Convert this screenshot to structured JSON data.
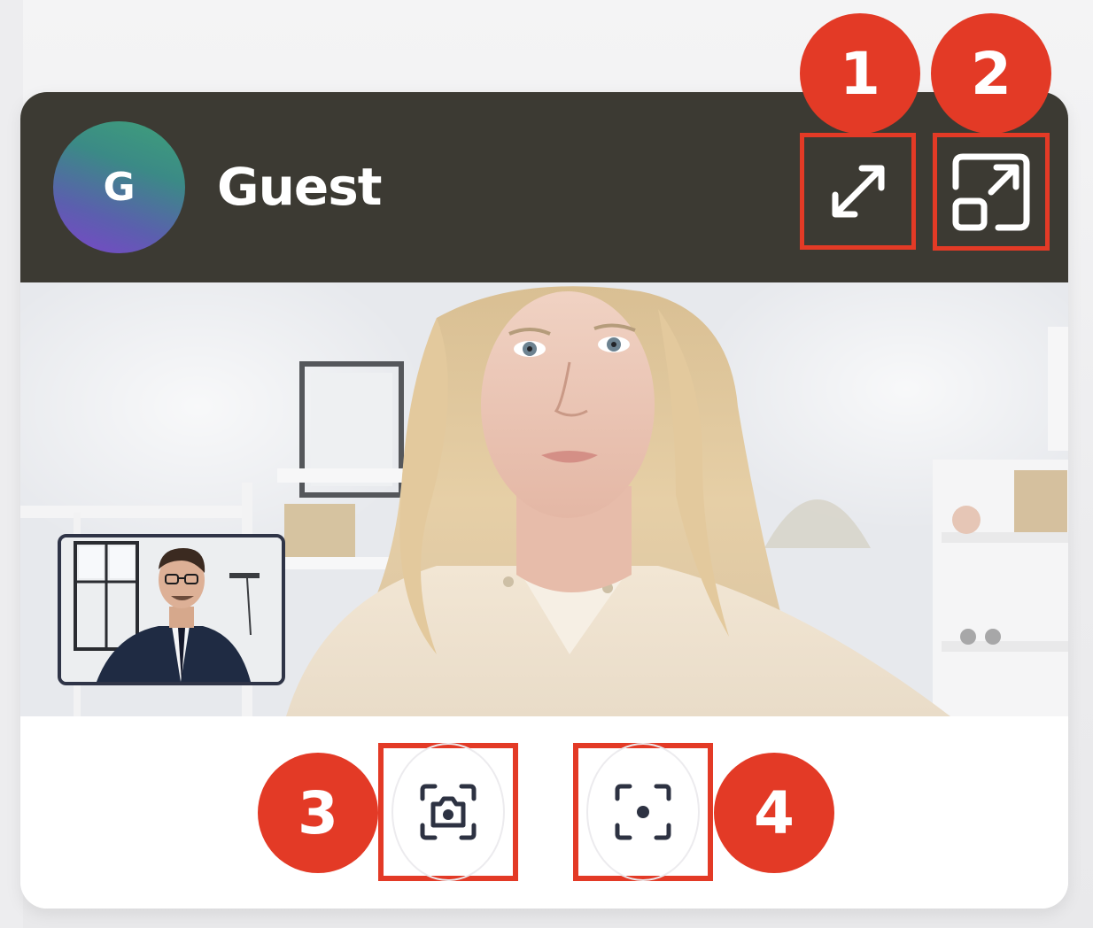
{
  "participant": {
    "avatar_initial": "G",
    "name": "Guest"
  },
  "header_actions": {
    "expand_icon": "expand-arrows-icon",
    "popout_icon": "picture-in-picture-popout-icon"
  },
  "controls": {
    "snapshot_icon": "camera-snapshot-icon",
    "focus_icon": "focus-target-icon"
  },
  "callouts": [
    "1",
    "2",
    "3",
    "4"
  ],
  "colors": {
    "header_bg": "#3c3a33",
    "callout_red": "#e33a26",
    "card_bg": "#ffffff"
  }
}
